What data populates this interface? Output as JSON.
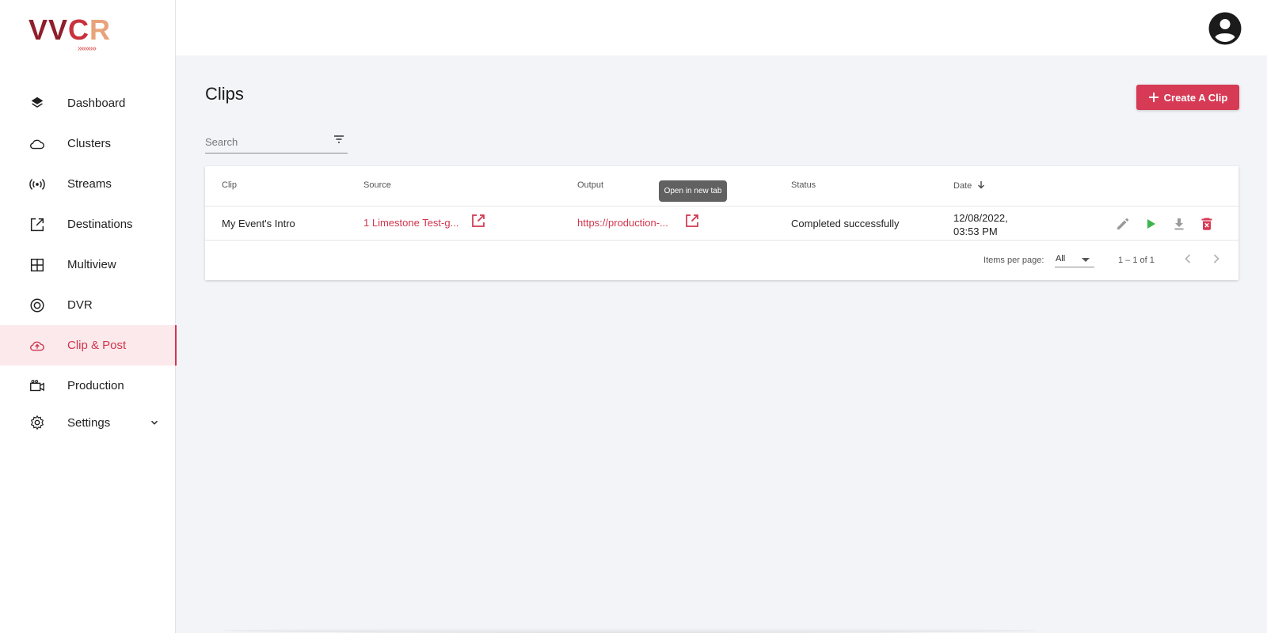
{
  "logo": {
    "part1": "VV",
    "part2": "C",
    "part3": "R",
    "arrows": "»»»»»"
  },
  "sidebar": {
    "items": [
      {
        "label": "Dashboard",
        "icon": "layers-icon"
      },
      {
        "label": "Clusters",
        "icon": "cloud-icon"
      },
      {
        "label": "Streams",
        "icon": "broadcast-icon"
      },
      {
        "label": "Destinations",
        "icon": "external-link-icon"
      },
      {
        "label": "Multiview",
        "icon": "grid-icon"
      },
      {
        "label": "DVR",
        "icon": "record-icon"
      },
      {
        "label": "Clip & Post",
        "icon": "cloud-upload-icon",
        "active": true
      },
      {
        "label": "Production",
        "icon": "video-camera-icon"
      },
      {
        "label": "Settings",
        "icon": "gear-icon",
        "expandable": true
      }
    ]
  },
  "header": {
    "avatar_icon": "account-circle-icon"
  },
  "main": {
    "title": "Clips",
    "create_button": "Create A Clip",
    "search": {
      "placeholder": "Search",
      "value": ""
    },
    "table": {
      "columns": {
        "clip": "Clip",
        "source": "Source",
        "output": "Output",
        "status": "Status",
        "date": "Date"
      },
      "sort": {
        "column": "Date",
        "direction": "descending"
      },
      "rows": [
        {
          "clip": "My Event's Intro",
          "source": "1 Limestone Test-g...",
          "output": "https://production-...",
          "status": "Completed successfully",
          "date_line1": "12/08/2022,",
          "date_line2": "03:53 PM"
        }
      ]
    },
    "tooltip": "Open in new tab",
    "pagination": {
      "items_per_page_label": "Items per page:",
      "items_per_page_value": "All",
      "range": "1 – 1 of 1"
    }
  },
  "colors": {
    "accent": "#d0354d",
    "button": "#d63a55",
    "play": "#3cb54a",
    "delete": "#d63a55"
  }
}
